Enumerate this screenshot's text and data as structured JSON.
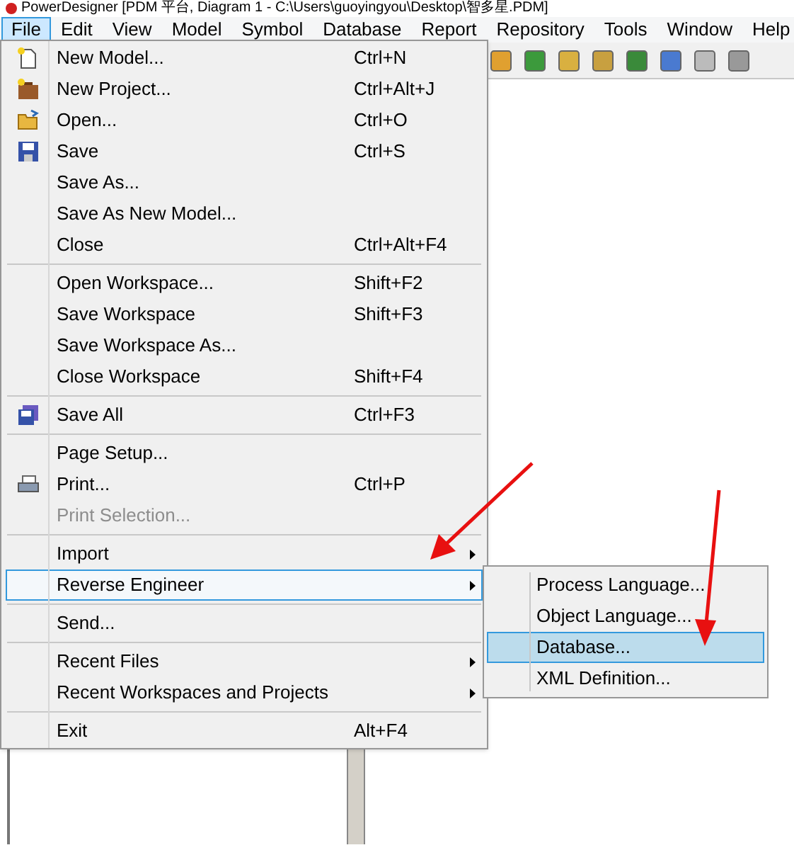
{
  "window": {
    "title": "PowerDesigner [PDM 平台, Diagram 1 - C:\\Users\\guoyingyou\\Desktop\\智多星.PDM]"
  },
  "menubar": [
    {
      "label": "File",
      "selected": true
    },
    {
      "label": "Edit",
      "selected": false
    },
    {
      "label": "View",
      "selected": false
    },
    {
      "label": "Model",
      "selected": false
    },
    {
      "label": "Symbol",
      "selected": false
    },
    {
      "label": "Database",
      "selected": false
    },
    {
      "label": "Report",
      "selected": false
    },
    {
      "label": "Repository",
      "selected": false
    },
    {
      "label": "Tools",
      "selected": false
    },
    {
      "label": "Window",
      "selected": false
    },
    {
      "label": "Help",
      "selected": false
    }
  ],
  "file_menu": {
    "groups": [
      [
        {
          "label": "New Model...",
          "shortcut": "Ctrl+N"
        },
        {
          "label": "New Project...",
          "shortcut": "Ctrl+Alt+J"
        },
        {
          "label": "Open...",
          "shortcut": "Ctrl+O"
        },
        {
          "label": "Save",
          "shortcut": "Ctrl+S"
        },
        {
          "label": "Save As..."
        },
        {
          "label": "Save As New Model..."
        },
        {
          "label": "Close",
          "shortcut": "Ctrl+Alt+F4"
        }
      ],
      [
        {
          "label": "Open Workspace...",
          "shortcut": "Shift+F2"
        },
        {
          "label": "Save Workspace",
          "shortcut": "Shift+F3"
        },
        {
          "label": "Save Workspace As..."
        },
        {
          "label": "Close Workspace",
          "shortcut": "Shift+F4"
        }
      ],
      [
        {
          "label": "Save All",
          "shortcut": "Ctrl+F3"
        }
      ],
      [
        {
          "label": "Page Setup..."
        },
        {
          "label": "Print...",
          "shortcut": "Ctrl+P"
        },
        {
          "label": "Print Selection...",
          "disabled": true
        }
      ],
      [
        {
          "label": "Import",
          "submenu": true,
          "selected": false
        },
        {
          "label": "Reverse Engineer",
          "submenu": true,
          "selected": true
        }
      ],
      [
        {
          "label": "Send..."
        }
      ],
      [
        {
          "label": "Recent Files",
          "submenu": true,
          "selected": false
        },
        {
          "label": "Recent Workspaces and Projects",
          "submenu": true,
          "selected": false
        }
      ],
      [
        {
          "label": "Exit",
          "shortcut": "Alt+F4"
        }
      ]
    ]
  },
  "reverse_engineer_menu": [
    {
      "label": "Process Language...",
      "selected": false
    },
    {
      "label": "Object Language...",
      "selected": false
    },
    {
      "label": "Database...",
      "selected": true
    },
    {
      "label": "XML Definition...",
      "selected": false
    }
  ]
}
